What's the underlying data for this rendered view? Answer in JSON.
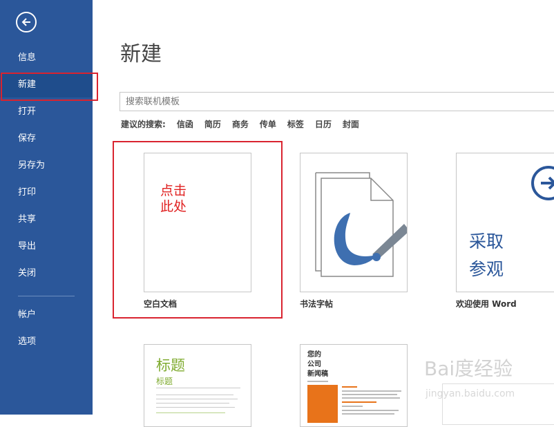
{
  "sidebar": {
    "back_label": "",
    "items": [
      {
        "label": "信息"
      },
      {
        "label": "新建"
      },
      {
        "label": "打开"
      },
      {
        "label": "保存"
      },
      {
        "label": "另存为"
      },
      {
        "label": "打印"
      },
      {
        "label": "共享"
      },
      {
        "label": "导出"
      },
      {
        "label": "关闭"
      },
      {
        "label": "帐户"
      },
      {
        "label": "选项"
      }
    ],
    "selected": "新建"
  },
  "main": {
    "title": "新建",
    "search": {
      "placeholder": "搜索联机模板"
    },
    "suggestions_label": "建议的搜索:",
    "suggestions": [
      "信函",
      "简历",
      "商务",
      "传单",
      "标签",
      "日历",
      "封面"
    ]
  },
  "templates": [
    {
      "label": "空白文档",
      "annotation_line1": "点击",
      "annotation_line2": "此处"
    },
    {
      "label": "书法字帖"
    },
    {
      "label": "欢迎使用 Word",
      "body_line1": "采取",
      "body_line2": "参观"
    },
    {
      "label": "",
      "preview_title": "标题",
      "preview_subtitle": "标题"
    },
    {
      "label": "",
      "preview_title_l1": "您的",
      "preview_title_l2": "公司",
      "preview_title_l3": "新闻稿"
    }
  ],
  "watermark": {
    "line1": "Bai度经验",
    "line2": "jingyan.baidu.com"
  },
  "colors": {
    "sidebar": "#2b579a",
    "accent_red": "#d9232f",
    "green": "#7fab2f",
    "orange": "#e8731a"
  }
}
